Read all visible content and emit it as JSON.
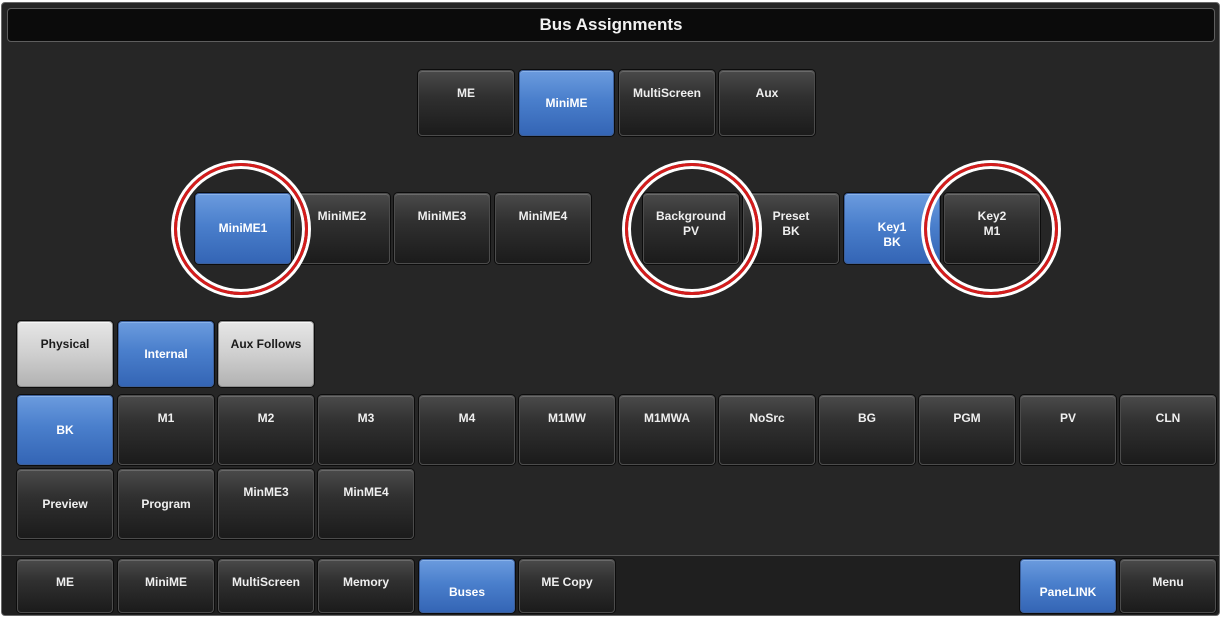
{
  "title": "Bus Assignments",
  "colors": {
    "accent": "#4a7fcc",
    "highlight_ring": "#d41c1c"
  },
  "bus_type_tabs": [
    {
      "label": "ME",
      "selected": false
    },
    {
      "label": "MiniME",
      "selected": true
    },
    {
      "label": "MultiScreen",
      "selected": false
    },
    {
      "label": "Aux",
      "selected": false
    }
  ],
  "minime_select": [
    {
      "label": "MiniME1",
      "selected": true,
      "circled": true
    },
    {
      "label": "MiniME2",
      "selected": false
    },
    {
      "label": "MiniME3",
      "selected": false
    },
    {
      "label": "MiniME4",
      "selected": false
    }
  ],
  "bus_select": [
    {
      "line1": "Background",
      "line2": "PV",
      "selected": false,
      "circled": true
    },
    {
      "line1": "Preset",
      "line2": "BK",
      "selected": false
    },
    {
      "line1": "Key1",
      "line2": "BK",
      "selected": true
    },
    {
      "line1": "Key2",
      "line2": "M1",
      "selected": false,
      "circled": true
    }
  ],
  "source_mode": [
    {
      "label": "Physical",
      "selected": false
    },
    {
      "label": "Internal",
      "selected": true
    },
    {
      "label": "Aux Follows",
      "selected": false
    }
  ],
  "sources_row1": [
    "BK",
    "M1",
    "M2",
    "M3",
    "M4",
    "M1MW",
    "M1MWA",
    "NoSrc",
    "BG",
    "PGM",
    "PV",
    "CLN"
  ],
  "sources_row1_selected": "BK",
  "sources_row2": [
    "Preview",
    "Program",
    "MinME3",
    "MinME4"
  ],
  "nav": [
    {
      "label": "ME",
      "selected": false
    },
    {
      "label": "MiniME",
      "selected": false
    },
    {
      "label": "MultiScreen",
      "selected": false
    },
    {
      "label": "Memory",
      "selected": false
    },
    {
      "label": "Buses",
      "selected": true
    },
    {
      "label": "ME Copy",
      "selected": false
    }
  ],
  "nav_right": [
    {
      "label": "PaneLINK",
      "selected": true
    },
    {
      "label": "Menu",
      "selected": false
    }
  ]
}
